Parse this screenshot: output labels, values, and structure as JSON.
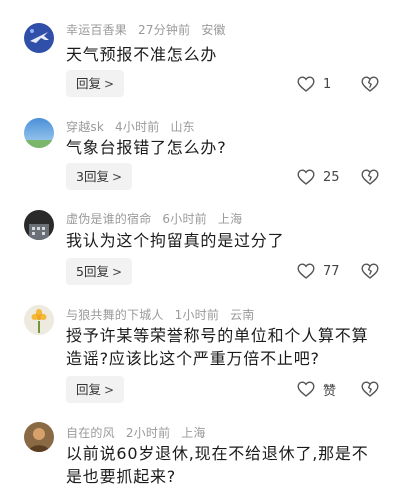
{
  "comments": [
    {
      "username": "幸运百香果",
      "time": "27分钟前",
      "location": "安徽",
      "text": "天气预报不准怎么办",
      "reply_label": "回复",
      "likes": "1",
      "avatar_icon": "airplane-avatar-icon"
    },
    {
      "username": "穿越sk",
      "time": "4小时前",
      "location": "山东",
      "text": "气象台报错了怎么办?",
      "reply_label": "3回复",
      "likes": "25",
      "avatar_icon": "sky-avatar-icon"
    },
    {
      "username": "虚伪是谁的宿命",
      "time": "6小时前",
      "location": "上海",
      "text": "我认为这个拘留真的是过分了",
      "reply_label": "5回复",
      "likes": "77",
      "avatar_icon": "building-avatar-icon"
    },
    {
      "username": "与狼共舞的下城人",
      "time": "1小时前",
      "location": "云南",
      "text": "授予许某等荣誉称号的单位和个人算不算造谣?应该比这个严重万倍不止吧?",
      "reply_label": "回复",
      "likes": "赞",
      "avatar_icon": "flower-avatar-icon"
    },
    {
      "username": "自在的风",
      "time": "2小时前",
      "location": "上海",
      "text": "以前说60岁退休,现在不给退休了,那是不是也要抓起来?",
      "avatar_icon": "person-avatar-icon"
    }
  ],
  "icons": {
    "reply_chevron": ">",
    "like": "heart-outline-icon",
    "dislike": "broken-heart-icon"
  }
}
